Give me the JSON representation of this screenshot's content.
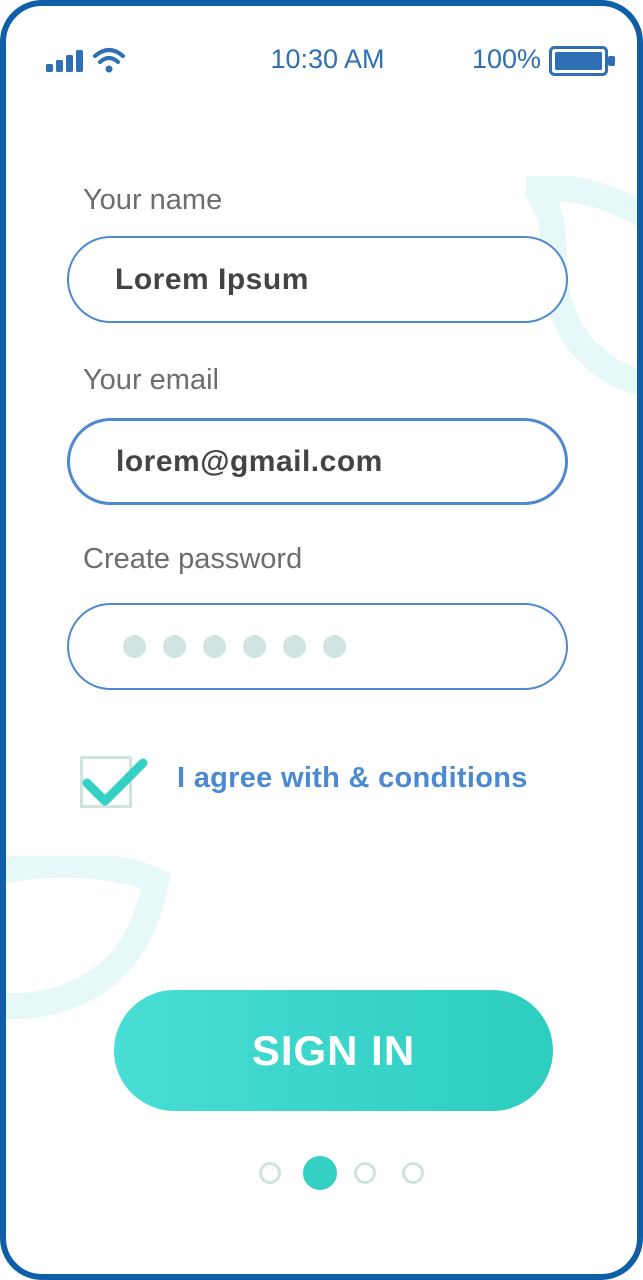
{
  "status_bar": {
    "time": "10:30 AM",
    "battery_percent": "100%",
    "icons": [
      "signal-icon",
      "wifi-icon",
      "battery-icon"
    ]
  },
  "form": {
    "name": {
      "label": "Your name",
      "value": "Lorem Ipsum"
    },
    "email": {
      "label": "Your email",
      "value": "lorem@gmail.com"
    },
    "password": {
      "label": "Create password",
      "masked_length": 6
    },
    "agree": {
      "checked": true,
      "label": "I agree with & conditions"
    }
  },
  "sign_in": {
    "label": "SIGN IN"
  },
  "pager": {
    "total": 4,
    "active_index": 1
  },
  "colors": {
    "frame": "#0f5ea7",
    "accent_blue": "#4a8ad2",
    "teal": "#35d0c4",
    "pale_teal": "#cfe3e0",
    "text_gray": "#6d6d6d"
  }
}
